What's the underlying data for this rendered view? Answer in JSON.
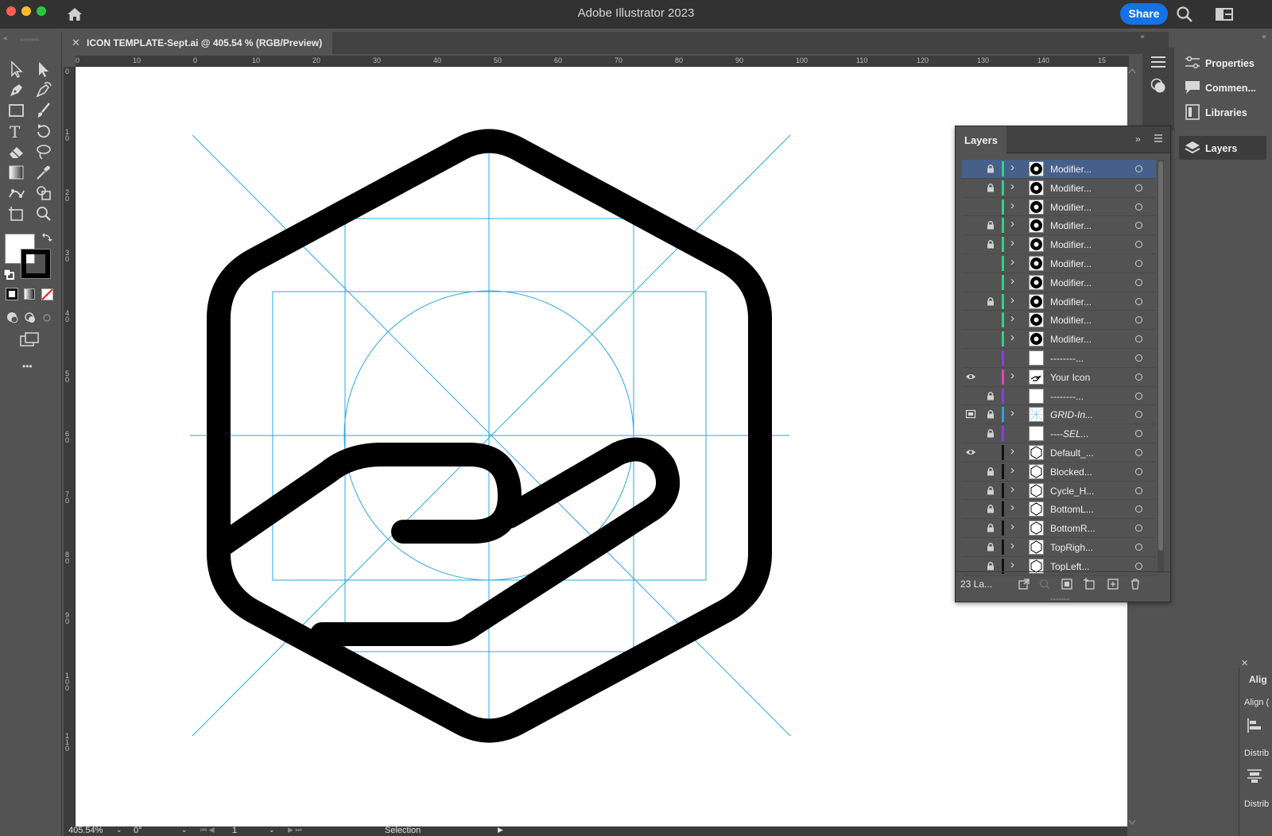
{
  "window": {
    "app_title": "Adobe Illustrator 2023",
    "share_label": "Share",
    "colors": {
      "accent": "#1473e6",
      "close": "#ff5f57",
      "minimize": "#febc2e",
      "zoom": "#28c840",
      "guide": "#29a8e0"
    }
  },
  "document_tab": {
    "close_glyph": "✕",
    "label": "ICON TEMPLATE-Sept.ai @ 405.54 % (RGB/Preview)"
  },
  "ruler_top": {
    "ticks": [
      "0",
      "10",
      "0",
      "10",
      "20",
      "30",
      "40",
      "50",
      "60",
      "70",
      "80",
      "90",
      "100",
      "110",
      "120",
      "130",
      "140",
      "15"
    ]
  },
  "ruler_left": {
    "ticks": [
      "0",
      "10",
      "20",
      "30",
      "40",
      "50",
      "60",
      "70",
      "80",
      "90",
      "100",
      "110"
    ]
  },
  "toolbar": {
    "tools": [
      "selection-tool",
      "direct-selection-tool",
      "pen-tool",
      "curvature-tool",
      "rectangle-tool",
      "paintbrush-tool",
      "type-tool",
      "rotate-tool",
      "eraser-tool",
      "lasso-tool",
      "gradient-tool",
      "eyedropper-tool",
      "puppet-warp-tool",
      "shape-builder-tool",
      "artboard-tool",
      "zoom-tool"
    ],
    "more_glyph": "•••"
  },
  "status_bar": {
    "zoom": "405.54%",
    "rotation": "0°",
    "artboard_number": "1",
    "mode": "Selection"
  },
  "right_dock": {
    "items": [
      {
        "icon": "properties-icon",
        "label": "Properties"
      },
      {
        "icon": "comments-icon",
        "label": "Commen..."
      },
      {
        "icon": "libraries-icon",
        "label": "Libraries"
      },
      {
        "icon": "layers-icon",
        "label": "Layers"
      }
    ]
  },
  "align_panel": {
    "title": "Alig",
    "align_label": "Align (",
    "distribute_label_1": "Distrib",
    "distribute_label_2": "Distrib"
  },
  "layers_panel": {
    "title": "Layers",
    "collapse_glyph": "»",
    "count_label": "23 La...",
    "rows": [
      {
        "name": "Modifier...",
        "visible": false,
        "locked": true,
        "color": "#2fd38a",
        "expandable": true,
        "thumb": "clock-icon",
        "selected": true
      },
      {
        "name": "Modifier...",
        "visible": false,
        "locked": true,
        "color": "#2fd38a",
        "expandable": true,
        "thumb": "x-circle-icon"
      },
      {
        "name": "Modifier...",
        "visible": false,
        "locked": false,
        "color": "#2fd38a",
        "expandable": true,
        "thumb": "equals-circle-icon"
      },
      {
        "name": "Modifier...",
        "visible": false,
        "locked": true,
        "color": "#2fd38a",
        "expandable": true,
        "thumb": "minus-circle-icon"
      },
      {
        "name": "Modifier...",
        "visible": false,
        "locked": true,
        "color": "#2fd38a",
        "expandable": true,
        "thumb": "plus-circle-icon"
      },
      {
        "name": "Modifier...",
        "visible": false,
        "locked": false,
        "color": "#2fd38a",
        "expandable": true,
        "thumb": "arrow-up-circle-icon"
      },
      {
        "name": "Modifier...",
        "visible": false,
        "locked": false,
        "color": "#2fd38a",
        "expandable": true,
        "thumb": "arrow-down-circle-icon"
      },
      {
        "name": "Modifier...",
        "visible": false,
        "locked": true,
        "color": "#2fd38a",
        "expandable": true,
        "thumb": "check-circle-icon"
      },
      {
        "name": "Modifier...",
        "visible": false,
        "locked": false,
        "color": "#2fd38a",
        "expandable": true,
        "thumb": "star-circle-icon"
      },
      {
        "name": "Modifier...",
        "visible": false,
        "locked": false,
        "color": "#2fd38a",
        "expandable": true,
        "thumb": "bolt-circle-icon"
      },
      {
        "name": "--------...",
        "visible": false,
        "locked": false,
        "color": "#8a3ee0",
        "expandable": false,
        "thumb": "blank"
      },
      {
        "name": "Your Icon",
        "visible": true,
        "locked": false,
        "color": "#e040c8",
        "expandable": true,
        "thumb": "hand-icon"
      },
      {
        "name": "--------...",
        "visible": false,
        "locked": true,
        "color": "#8a3ee0",
        "expandable": false,
        "thumb": "blank"
      },
      {
        "name": "GRID-In...",
        "visible": "outline",
        "locked": true,
        "color": "#2aa3e0",
        "expandable": true,
        "thumb": "grid-icon",
        "italic": true
      },
      {
        "name": "----SEL...",
        "visible": false,
        "locked": true,
        "color": "#8a3ee0",
        "expandable": false,
        "thumb": "blank",
        "italic": true
      },
      {
        "name": "Default_...",
        "visible": true,
        "locked": false,
        "color": "#111111",
        "expandable": true,
        "thumb": "hexagon-icon"
      },
      {
        "name": "Blocked...",
        "visible": false,
        "locked": true,
        "color": "#111111",
        "expandable": true,
        "thumb": "hexagon-icon"
      },
      {
        "name": "Cycle_H...",
        "visible": false,
        "locked": true,
        "color": "#111111",
        "expandable": true,
        "thumb": "hexagon-icon"
      },
      {
        "name": "BottomL...",
        "visible": false,
        "locked": true,
        "color": "#111111",
        "expandable": true,
        "thumb": "hexagon-icon"
      },
      {
        "name": "BottomR...",
        "visible": false,
        "locked": true,
        "color": "#111111",
        "expandable": true,
        "thumb": "hexagon-icon"
      },
      {
        "name": "TopRigh...",
        "visible": false,
        "locked": true,
        "color": "#111111",
        "expandable": true,
        "thumb": "hexagon-icon"
      },
      {
        "name": "TopLeft...",
        "visible": false,
        "locked": true,
        "color": "#111111",
        "expandable": true,
        "thumb": "hexagon-icon"
      }
    ]
  }
}
